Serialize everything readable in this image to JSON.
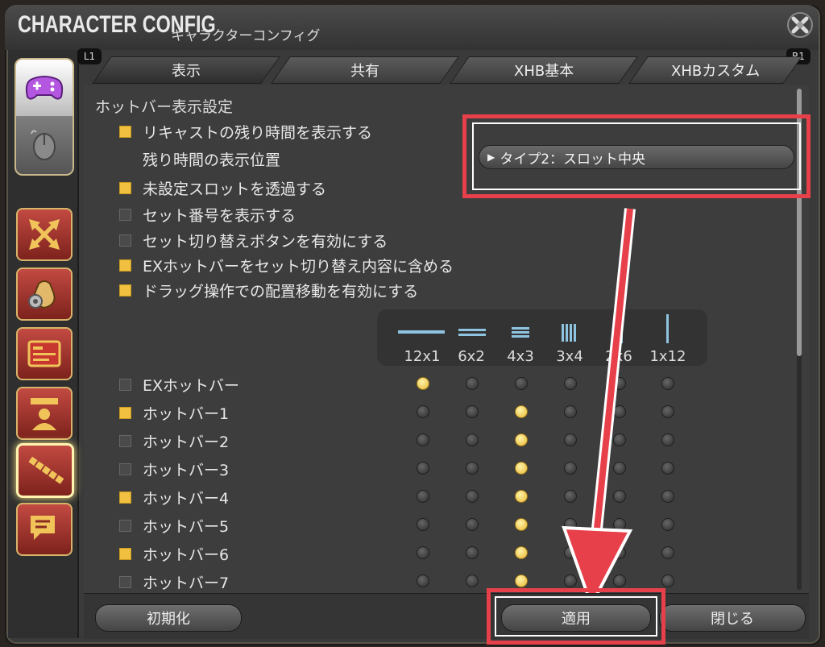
{
  "window": {
    "title_main": "CHARACTER CONFIG",
    "title_sub": "キャラクターコンフィグ"
  },
  "tabs": [
    {
      "label": "表示"
    },
    {
      "label": "共有"
    },
    {
      "label": "XHB基本"
    },
    {
      "label": "XHBカスタム"
    }
  ],
  "tab_hints": {
    "left": "L1",
    "right": "R1"
  },
  "section": {
    "title": "ホットバー表示設定"
  },
  "options": [
    {
      "label": "リキャストの残り時間を表示する",
      "checked": true
    },
    {
      "label": "未設定スロットを透過する",
      "checked": true
    },
    {
      "label": "セット番号を表示する",
      "checked": false
    },
    {
      "label": "セット切り替えボタンを有効にする",
      "checked": false
    },
    {
      "label": "EXホットバーをセット切り替え内容に含める",
      "checked": true
    },
    {
      "label": "ドラッグ操作での配置移動を有効にする",
      "checked": true
    }
  ],
  "recast_position": {
    "label": "残り時間の表示位置",
    "value": "タイプ2：スロット中央"
  },
  "layouts": [
    "12x1",
    "6x2",
    "4x3",
    "3x4",
    "2x6",
    "1x12"
  ],
  "hotbars": [
    {
      "label": "EXホットバー",
      "checked": false,
      "layout": 0
    },
    {
      "label": "ホットバー1",
      "checked": true,
      "layout": 2
    },
    {
      "label": "ホットバー2",
      "checked": false,
      "layout": 2
    },
    {
      "label": "ホットバー3",
      "checked": false,
      "layout": 2
    },
    {
      "label": "ホットバー4",
      "checked": true,
      "layout": 2
    },
    {
      "label": "ホットバー5",
      "checked": false,
      "layout": 2
    },
    {
      "label": "ホットバー6",
      "checked": true,
      "layout": 2
    },
    {
      "label": "ホットバー7",
      "checked": false,
      "layout": 2
    }
  ],
  "buttons": {
    "reset": "初期化",
    "apply": "適用",
    "close": "閉じる"
  },
  "colors": {
    "accent": "#f2c040",
    "highlight": "#e8404a"
  }
}
